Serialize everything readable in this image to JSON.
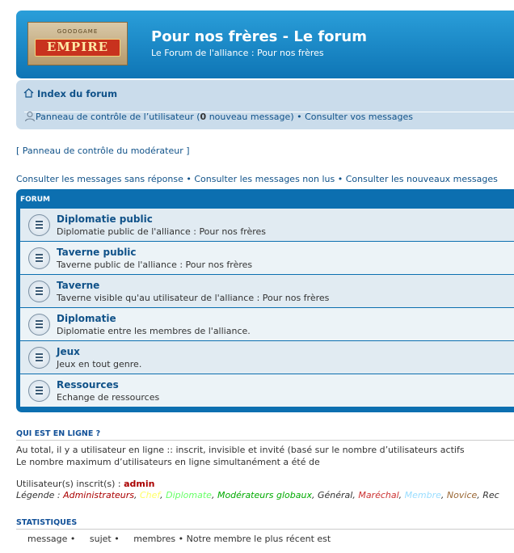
{
  "header": {
    "logo_top": "GOODGAME",
    "logo_brand": "EMPIRE",
    "title": "Pour nos frères - Le forum",
    "description": "Le Forum de l'alliance : Pour nos frères"
  },
  "navbar": {
    "index_label": "Index du forum",
    "ucp_label": "Panneau de contrôle de l’utilisateur",
    "new_count": "0",
    "new_text": "nouveau message",
    "messages_label": "Consulter vos messages"
  },
  "mcp_label": "Panneau de contrôle du modérateur",
  "search_links": [
    "Consulter les messages sans réponse",
    "Consulter les messages non lus",
    "Consulter les nouveaux messages"
  ],
  "forum_header": "FORUM",
  "forums": [
    {
      "title": "Diplomatie public",
      "desc": "Diplomatie public de l'alliance : Pour nos frères"
    },
    {
      "title": "Taverne public",
      "desc": "Taverne public de l'alliance : Pour nos frères"
    },
    {
      "title": "Taverne",
      "desc": "Taverne visible qu'au utilisateur de l'alliance : Pour nos frères"
    },
    {
      "title": "Diplomatie",
      "desc": "Diplomatie entre les membres de l'alliance."
    },
    {
      "title": "Jeux",
      "desc": "Jeux en tout genre."
    },
    {
      "title": "Ressources",
      "desc": "Echange de ressources"
    }
  ],
  "online": {
    "title": "QUI EST EN LIGNE ?",
    "line1": "Au total, il y a    utilisateur en ligne ::    inscrit,    invisible et    invité (basé sur le nombre d’utilisateurs actifs",
    "line2": "Le nombre maximum d’utilisateurs en ligne simultanément a été de",
    "registered_label": "Utilisateur(s) inscrit(s) :",
    "registered_user": "admin",
    "legend_label": "Légende :",
    "legend": [
      {
        "name": "Administrateurs",
        "color": "#aa0000"
      },
      {
        "name": "Chef",
        "color": "#ffff66"
      },
      {
        "name": "Diplomate",
        "color": "#66ff66"
      },
      {
        "name": "Modérateurs globaux",
        "color": "#00aa00"
      },
      {
        "name": "Général",
        "color": "#333333"
      },
      {
        "name": "Maréchal",
        "color": "#cc3333"
      },
      {
        "name": "Membre",
        "color": "#99ddff"
      },
      {
        "name": "Novice",
        "color": "#996633"
      },
      {
        "name": "Rec",
        "color": "#333333"
      }
    ]
  },
  "stats": {
    "title": "STATISTIQUES",
    "line": "    message •     sujet •     membres • Notre membre le plus récent est"
  }
}
